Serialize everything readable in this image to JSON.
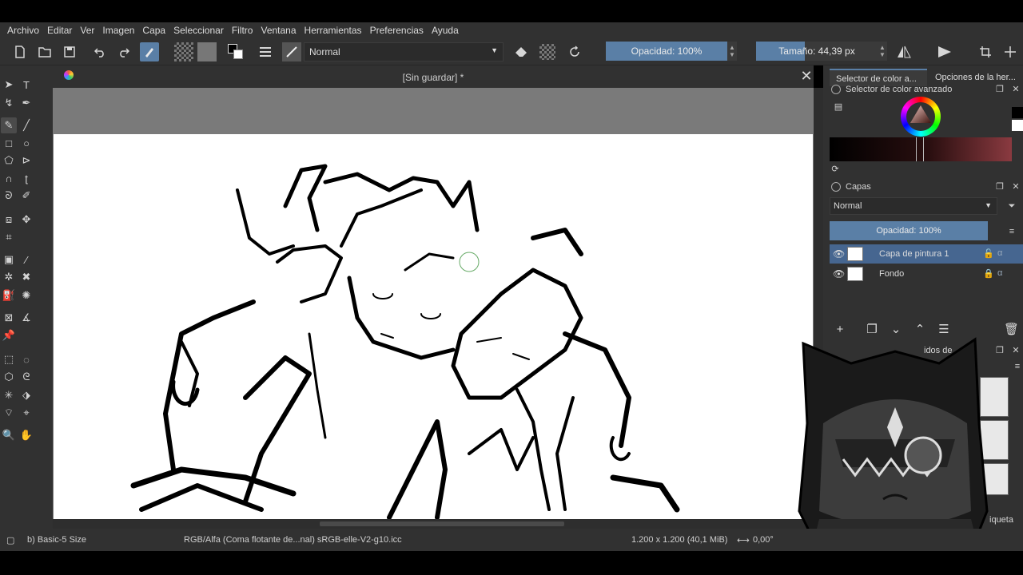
{
  "menu": [
    "Archivo",
    "Editar",
    "Ver",
    "Imagen",
    "Capa",
    "Seleccionar",
    "Filtro",
    "Ventana",
    "Herramientas",
    "Preferencias",
    "Ayuda"
  ],
  "toolbar": {
    "blend_mode": "Normal",
    "opacity_label": "Opacidad: 100%",
    "size_label": "Tamaño: 44,39 px"
  },
  "document": {
    "title": "[Sin guardar]  *"
  },
  "dock": {
    "tab_color_selector": "Selector de color a...",
    "tab_tool_options": "Opciones de la her...",
    "color_selector_title": "Selector de color avanzado",
    "layers_title": "Capas",
    "layers_blend": "Normal",
    "layers_opacity": "Opacidad:  100%",
    "layers": [
      {
        "name": "Capa de pintura 1",
        "selected": true
      },
      {
        "name": "Fondo",
        "selected": false
      }
    ],
    "brush_panel_partial": "idos de",
    "brush_tag_partial": "iqueta"
  },
  "status": {
    "brush": "b) Basic-5 Size",
    "color_space": "RGB/Alfa (Coma flotante de...nal)  sRGB-elle-V2-g10.icc",
    "dimensions": "1.200 x 1.200 (40,1 MiB)",
    "rotation": "0,00°"
  },
  "colors": {
    "accent": "#5a7fa6",
    "panel_bg": "#313131",
    "canvas_bg": "#7a7a7a"
  }
}
